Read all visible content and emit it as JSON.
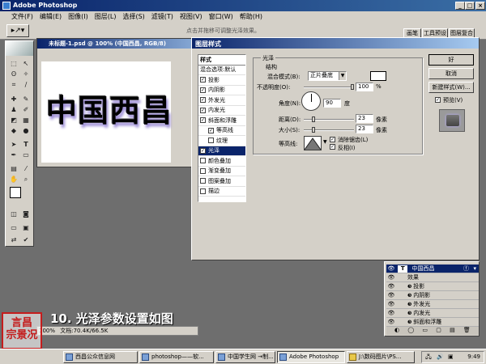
{
  "app": {
    "title": "Adobe Photoshop"
  },
  "menu": [
    "文件(F)",
    "编辑(E)",
    "图像(I)",
    "图层(L)",
    "选择(S)",
    "滤镜(T)",
    "视图(V)",
    "窗口(W)",
    "帮助(H)"
  ],
  "options_bar": {
    "hint": "点击并拖移可调整光泽效果。",
    "tabs": [
      "画笔",
      "工具预设",
      "图层复合"
    ]
  },
  "document": {
    "title": "未标题-1.psd @ 100% (中国西昌, RGB/8)",
    "canvas_text": "中国西昌",
    "status": "文档:70.4K/66.5K",
    "zoom": "100%"
  },
  "dialog": {
    "title": "图层样式",
    "styles": [
      {
        "label": "样式",
        "checked": null,
        "indent": false,
        "selected": false
      },
      {
        "label": "混合选项:默认",
        "checked": null,
        "indent": false,
        "selected": false
      },
      {
        "label": "投影",
        "checked": true,
        "indent": false,
        "selected": false
      },
      {
        "label": "内阴影",
        "checked": true,
        "indent": false,
        "selected": false
      },
      {
        "label": "外发光",
        "checked": true,
        "indent": false,
        "selected": false
      },
      {
        "label": "内发光",
        "checked": true,
        "indent": false,
        "selected": false
      },
      {
        "label": "斜面和浮雕",
        "checked": true,
        "indent": false,
        "selected": false
      },
      {
        "label": "等高线",
        "checked": true,
        "indent": true,
        "selected": false
      },
      {
        "label": "纹理",
        "checked": false,
        "indent": true,
        "selected": false
      },
      {
        "label": "光泽",
        "checked": true,
        "indent": false,
        "selected": true
      },
      {
        "label": "颜色叠加",
        "checked": false,
        "indent": false,
        "selected": false
      },
      {
        "label": "渐变叠加",
        "checked": false,
        "indent": false,
        "selected": false
      },
      {
        "label": "图案叠加",
        "checked": false,
        "indent": false,
        "selected": false
      },
      {
        "label": "描边",
        "checked": false,
        "indent": false,
        "selected": false
      }
    ],
    "section_title": "光泽",
    "structure_title": "结构",
    "blend_mode_label": "混合模式(B):",
    "blend_mode_value": "正片叠底",
    "opacity_label": "不透明度(O):",
    "opacity_value": "100",
    "opacity_unit": "%",
    "angle_label": "角度(N):",
    "angle_value": "90",
    "angle_unit": "度",
    "distance_label": "距离(D):",
    "distance_value": "23",
    "distance_unit": "像素",
    "size_label": "大小(S):",
    "size_value": "23",
    "size_unit": "像素",
    "contour_label": "等高线:",
    "antialias_label": "消除锯齿(L)",
    "invert_label": "反相(I)",
    "ok_label": "好",
    "cancel_label": "取消",
    "new_style_label": "新建样式(W)...",
    "preview_label": "预览(V)",
    "color_swatch": "#ffffff",
    "selected_color": "#0a246a"
  },
  "layers": {
    "layer_name": "中国西昌",
    "effects_label": "效果",
    "effects": [
      "投影",
      "内阴影",
      "外发光",
      "内发光",
      "斜面和浮雕"
    ]
  },
  "caption": "10. 光泽参数设置如图",
  "seal": "言昌\n宗景况",
  "taskbar": {
    "items": [
      "西昌公众信息网",
      "photoshop——软...",
      "中国学生网 →制...",
      "Adobe Photoshop",
      "J:\\数码图片\\PS..."
    ],
    "clock": "9:49"
  }
}
